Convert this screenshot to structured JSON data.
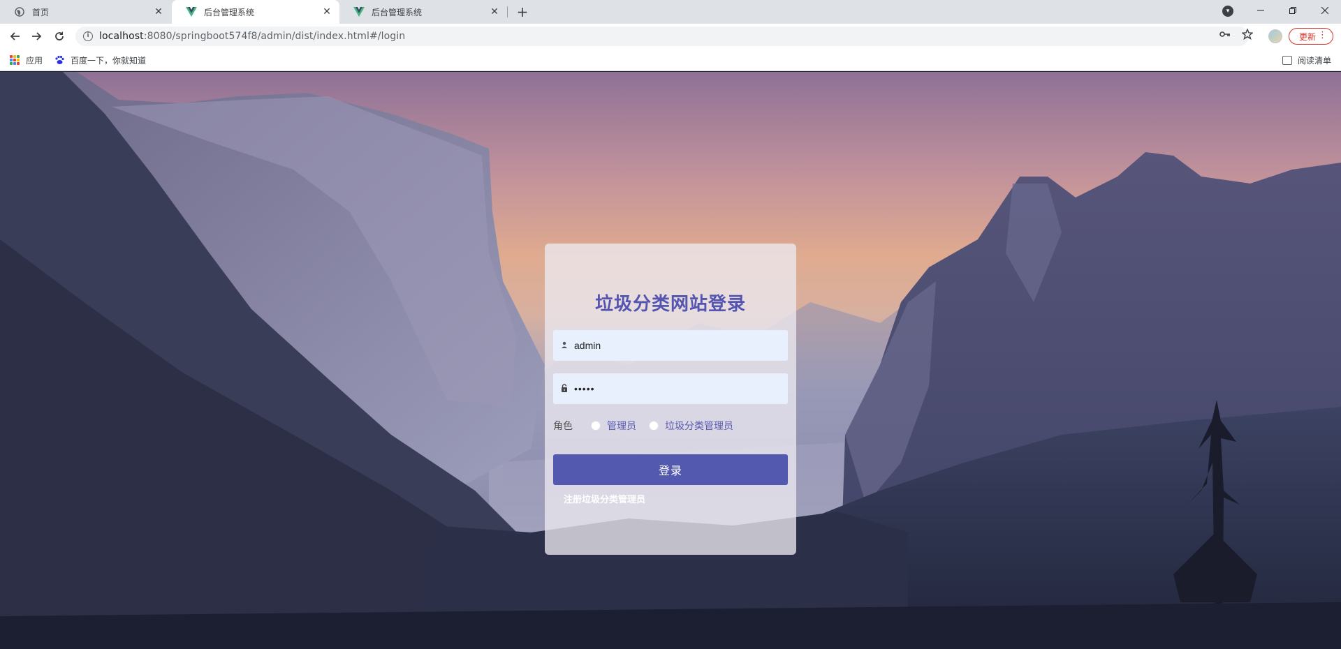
{
  "browser": {
    "tabs": [
      {
        "title": "首页",
        "active": false,
        "icon": "globe-icon"
      },
      {
        "title": "后台管理系统",
        "active": true,
        "icon": "vue-logo-icon"
      },
      {
        "title": "后台管理系统",
        "active": false,
        "icon": "vue-logo-icon"
      }
    ],
    "new_tab_symbol": "+",
    "address": {
      "host": "localhost",
      "path": ":8080/springboot574f8/admin/dist/index.html#/login"
    },
    "update_label": "更新",
    "bookmarks": [
      {
        "label": "应用",
        "icon": "apps-grid-icon"
      },
      {
        "label": "百度一下，你就知道",
        "icon": "baidu-paw-icon"
      }
    ],
    "reading_list_label": "阅读清单",
    "accent_color": "#d93025"
  },
  "login": {
    "title": "垃圾分类网站登录",
    "username_value": "admin",
    "password_value": "•••••",
    "role_label": "角色",
    "roles": [
      {
        "label": "管理员",
        "checked": false
      },
      {
        "label": "垃圾分类管理员",
        "checked": false
      }
    ],
    "submit_label": "登录",
    "register_label": "注册垃圾分类管理员",
    "title_color": "#5355b1",
    "button_color": "#5459b0"
  }
}
